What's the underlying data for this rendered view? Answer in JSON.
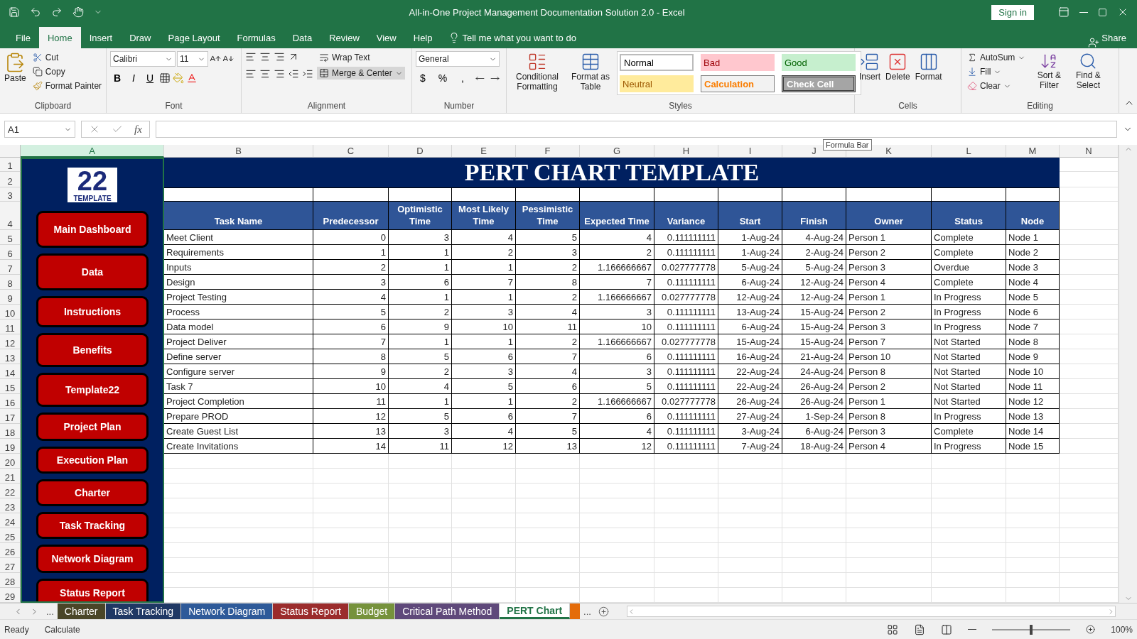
{
  "window": {
    "title": "All-in-One Project Management Documentation Solution 2.0  -  Excel",
    "sign_in": "Sign in"
  },
  "menu_tabs": [
    {
      "label": "File",
      "selected": false
    },
    {
      "label": "Home",
      "selected": true
    },
    {
      "label": "Insert",
      "selected": false
    },
    {
      "label": "Draw",
      "selected": false
    },
    {
      "label": "Page Layout",
      "selected": false
    },
    {
      "label": "Formulas",
      "selected": false
    },
    {
      "label": "Data",
      "selected": false
    },
    {
      "label": "Review",
      "selected": false
    },
    {
      "label": "View",
      "selected": false
    },
    {
      "label": "Help",
      "selected": false
    }
  ],
  "tell_me": "Tell me what you want to do",
  "share": "Share",
  "ribbon": {
    "clipboard": {
      "label": "Clipboard",
      "paste": "Paste",
      "cut": "Cut",
      "copy": "Copy",
      "format_painter": "Format Painter"
    },
    "font": {
      "label": "Font",
      "name": "Calibri",
      "size": "11",
      "styles": [
        "B",
        "I",
        "U"
      ]
    },
    "alignment": {
      "label": "Alignment",
      "wrap": "Wrap Text",
      "merge": "Merge & Center"
    },
    "number": {
      "label": "Number",
      "format": "General",
      "symbols": [
        "$",
        "%",
        ","
      ]
    },
    "styles": {
      "label": "Styles",
      "conditional": "Conditional Formatting",
      "format_table": "Format as Table",
      "cells": [
        {
          "label": "Normal",
          "kind": "normal"
        },
        {
          "label": "Bad",
          "kind": "bad"
        },
        {
          "label": "Good",
          "kind": "good"
        },
        {
          "label": "Neutral",
          "kind": "neutral"
        },
        {
          "label": "Calculation",
          "kind": "calc"
        },
        {
          "label": "Check Cell",
          "kind": "check"
        }
      ]
    },
    "cells": {
      "label": "Cells",
      "buttons": [
        "Insert",
        "Delete",
        "Format"
      ]
    },
    "editing": {
      "label": "Editing",
      "autosum": "AutoSum",
      "fill": "Fill",
      "clear": "Clear",
      "sort": "Sort & Filter",
      "find": "Find & Select"
    }
  },
  "formula_bar": {
    "name_box": "A1",
    "fx": "fx",
    "tooltip": "Formula Bar"
  },
  "sheet_frame": {
    "column_letters": [
      "A",
      "B",
      "C",
      "D",
      "E",
      "F",
      "G",
      "H",
      "I",
      "J",
      "K",
      "L",
      "M",
      "N"
    ],
    "row_numbers": [
      "1",
      "2",
      "3",
      "4",
      "5",
      "6",
      "7",
      "8",
      "9",
      "10",
      "11",
      "12",
      "13",
      "14",
      "15",
      "16",
      "17",
      "18",
      "19",
      "20",
      "21",
      "22",
      "23",
      "24",
      "25",
      "26",
      "27",
      "28",
      "29"
    ]
  },
  "sidebar": {
    "logo": {
      "number": "22",
      "word": "TEMPLATE"
    },
    "nav_buttons": [
      "Main Dashboard",
      "Data",
      "Instructions",
      "Benefits",
      "Template22",
      "Project Plan",
      "Execution Plan",
      "Charter",
      "Task Tracking",
      "Network Diagram",
      "Status Report"
    ]
  },
  "table": {
    "title": "PERT CHART TEMPLATE",
    "headers": [
      "Task Name",
      "Predecessor",
      "Optimistic Time",
      "Most Likely Time",
      "Pessimistic Time",
      "Expected Time",
      "Variance",
      "Start",
      "Finish",
      "Owner",
      "Status",
      "Node"
    ],
    "rows": [
      [
        "Meet Client",
        "0",
        "3",
        "4",
        "5",
        "4",
        "0.111111111",
        "1-Aug-24",
        "4-Aug-24",
        "Person 1",
        "Complete",
        "Node 1"
      ],
      [
        "Requirements",
        "1",
        "1",
        "2",
        "3",
        "2",
        "0.111111111",
        "1-Aug-24",
        "2-Aug-24",
        "Person 2",
        "Complete",
        "Node 2"
      ],
      [
        "Inputs",
        "2",
        "1",
        "1",
        "2",
        "1.166666667",
        "0.027777778",
        "5-Aug-24",
        "5-Aug-24",
        "Person 3",
        "Overdue",
        "Node 3"
      ],
      [
        "Design",
        "3",
        "6",
        "7",
        "8",
        "7",
        "0.111111111",
        "6-Aug-24",
        "12-Aug-24",
        "Person 4",
        "Complete",
        "Node 4"
      ],
      [
        "Project Testing",
        "4",
        "1",
        "1",
        "2",
        "1.166666667",
        "0.027777778",
        "12-Aug-24",
        "12-Aug-24",
        "Person 1",
        "In Progress",
        "Node 5"
      ],
      [
        "Process",
        "5",
        "2",
        "3",
        "4",
        "3",
        "0.111111111",
        "13-Aug-24",
        "15-Aug-24",
        "Person 2",
        "In Progress",
        "Node 6"
      ],
      [
        "Data model",
        "6",
        "9",
        "10",
        "11",
        "10",
        "0.111111111",
        "6-Aug-24",
        "15-Aug-24",
        "Person 3",
        "In Progress",
        "Node 7"
      ],
      [
        "Project Deliver",
        "7",
        "1",
        "1",
        "2",
        "1.166666667",
        "0.027777778",
        "15-Aug-24",
        "15-Aug-24",
        "Person 7",
        "Not Started",
        "Node 8"
      ],
      [
        "Define server",
        "8",
        "5",
        "6",
        "7",
        "6",
        "0.111111111",
        "16-Aug-24",
        "21-Aug-24",
        "Person 10",
        "Not Started",
        "Node 9"
      ],
      [
        "Configure server",
        "9",
        "2",
        "3",
        "4",
        "3",
        "0.111111111",
        "22-Aug-24",
        "24-Aug-24",
        "Person 8",
        "Not Started",
        "Node 10"
      ],
      [
        "Task 7",
        "10",
        "4",
        "5",
        "6",
        "5",
        "0.111111111",
        "22-Aug-24",
        "26-Aug-24",
        "Person 2",
        "Not Started",
        "Node 11"
      ],
      [
        "Project Completion",
        "11",
        "1",
        "1",
        "2",
        "1.166666667",
        "0.027777778",
        "26-Aug-24",
        "26-Aug-24",
        "Person 1",
        "Not Started",
        "Node 12"
      ],
      [
        "Prepare PROD",
        "12",
        "5",
        "6",
        "7",
        "6",
        "0.111111111",
        "27-Aug-24",
        "1-Sep-24",
        "Person 8",
        "In Progress",
        "Node 13"
      ],
      [
        "Create Guest List",
        "13",
        "3",
        "4",
        "5",
        "4",
        "0.111111111",
        "3-Aug-24",
        "6-Aug-24",
        "Person 3",
        "Complete",
        "Node 14"
      ],
      [
        "Create Invitations",
        "14",
        "11",
        "12",
        "13",
        "12",
        "0.111111111",
        "7-Aug-24",
        "18-Aug-24",
        "Person 4",
        "In Progress",
        "Node 15"
      ]
    ]
  },
  "sheet_tabs": [
    {
      "label": "Charter",
      "color": "#4a4628",
      "selected": false
    },
    {
      "label": "Task Tracking",
      "color": "#1f3864",
      "selected": false
    },
    {
      "label": "Network Diagram",
      "color": "#2e5a99",
      "selected": false
    },
    {
      "label": "Status Report",
      "color": "#9b2c2c",
      "selected": false
    },
    {
      "label": "Budget",
      "color": "#76923c",
      "selected": false
    },
    {
      "label": "Critical Path Method",
      "color": "#5f497a",
      "selected": false
    },
    {
      "label": "PERT Chart",
      "color": "#217346",
      "selected": true
    }
  ],
  "more_tabs": "...",
  "hidden_tabs": "...",
  "status_bar": {
    "left": [
      "Ready",
      "Calculate"
    ],
    "zoom": "100%",
    "zoom_slider": {
      "level": 0.5
    }
  }
}
